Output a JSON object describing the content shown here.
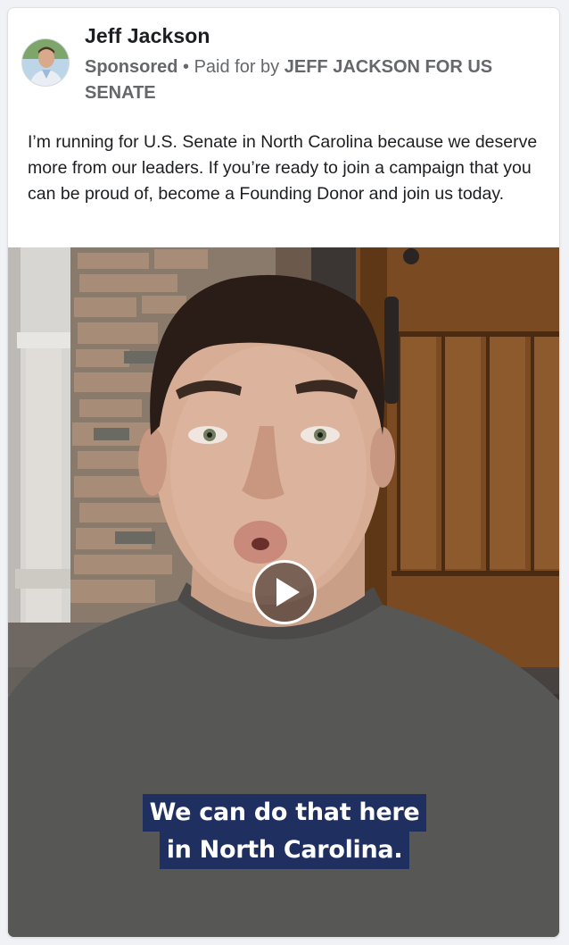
{
  "post": {
    "author": "Jeff Jackson",
    "sponsored_label": "Sponsored",
    "separator": " • ",
    "paid_for_prefix": "Paid for by ",
    "paid_for_entity": "JEFF JACKSON FOR US SENATE",
    "body": "I’m running for U.S. Senate in North Carolina because we deserve more from our leaders. If you’re ready to join a campaign that you can be proud of, become a Founding Donor and join us today."
  },
  "video": {
    "caption_line_1": "We can do that here",
    "caption_line_2": "in North Carolina.",
    "play_icon": "play-icon"
  },
  "colors": {
    "caption_bg": "#1f2f5f",
    "meta_text": "#65676b",
    "body_text": "#1c1e21"
  }
}
